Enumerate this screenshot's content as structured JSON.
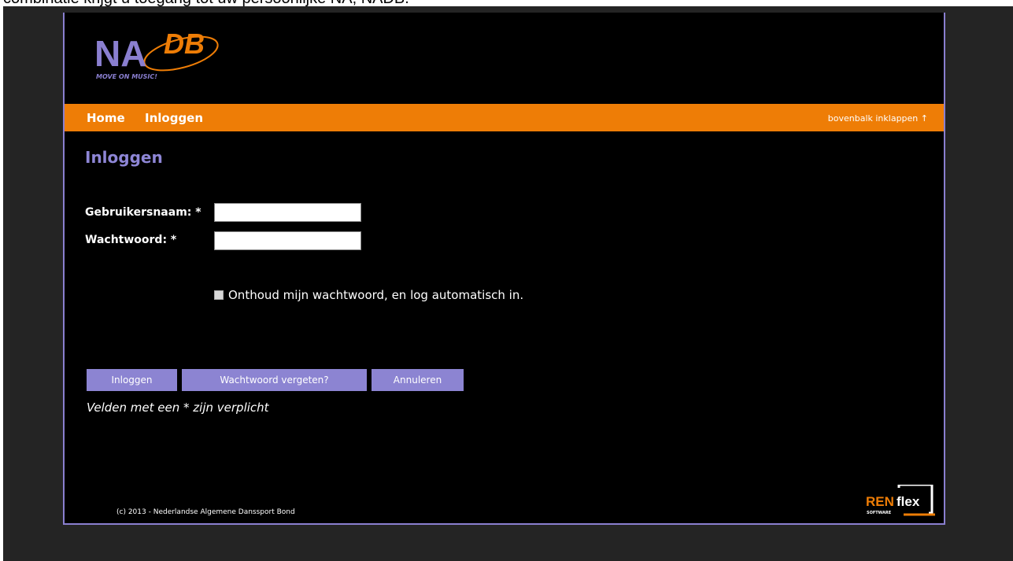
{
  "top_note": "combinatie krijgt u toegang tot uw persoonlijke NA, NADB.",
  "logo": {
    "brand_left": "NA",
    "brand_right": "DB",
    "tagline": "MOVE ON MUSIC!",
    "colors": {
      "left": "#8a7fd0",
      "right": "#ee7d06"
    }
  },
  "nav": {
    "items": [
      {
        "label": "Home"
      },
      {
        "label": "Inloggen"
      }
    ],
    "collapse_label": "bovenbalk inklappen ↑"
  },
  "page": {
    "title": "Inloggen"
  },
  "form": {
    "username_label": "Gebruikersnaam: *",
    "username_value": "",
    "password_label": "Wachtwoord: *",
    "password_value": "",
    "remember_label": "Onthoud mijn wachtwoord, en log automatisch in.",
    "remember_checked": false
  },
  "buttons": {
    "login": "Inloggen",
    "forgot": "Wachtwoord vergeten?",
    "cancel": "Annuleren"
  },
  "required_note": "Velden met een * zijn verplicht",
  "footer": {
    "copyright": "(c) 2013 - Nederlandse Algemene Danssport Bond",
    "vendor_logo_left": "REN",
    "vendor_logo_right": "flex",
    "vendor_logo_sub": "SOFTWARE"
  },
  "colors": {
    "accent_orange": "#ee7d06",
    "accent_purple": "#8c84d2",
    "panel_bg": "#000000"
  }
}
